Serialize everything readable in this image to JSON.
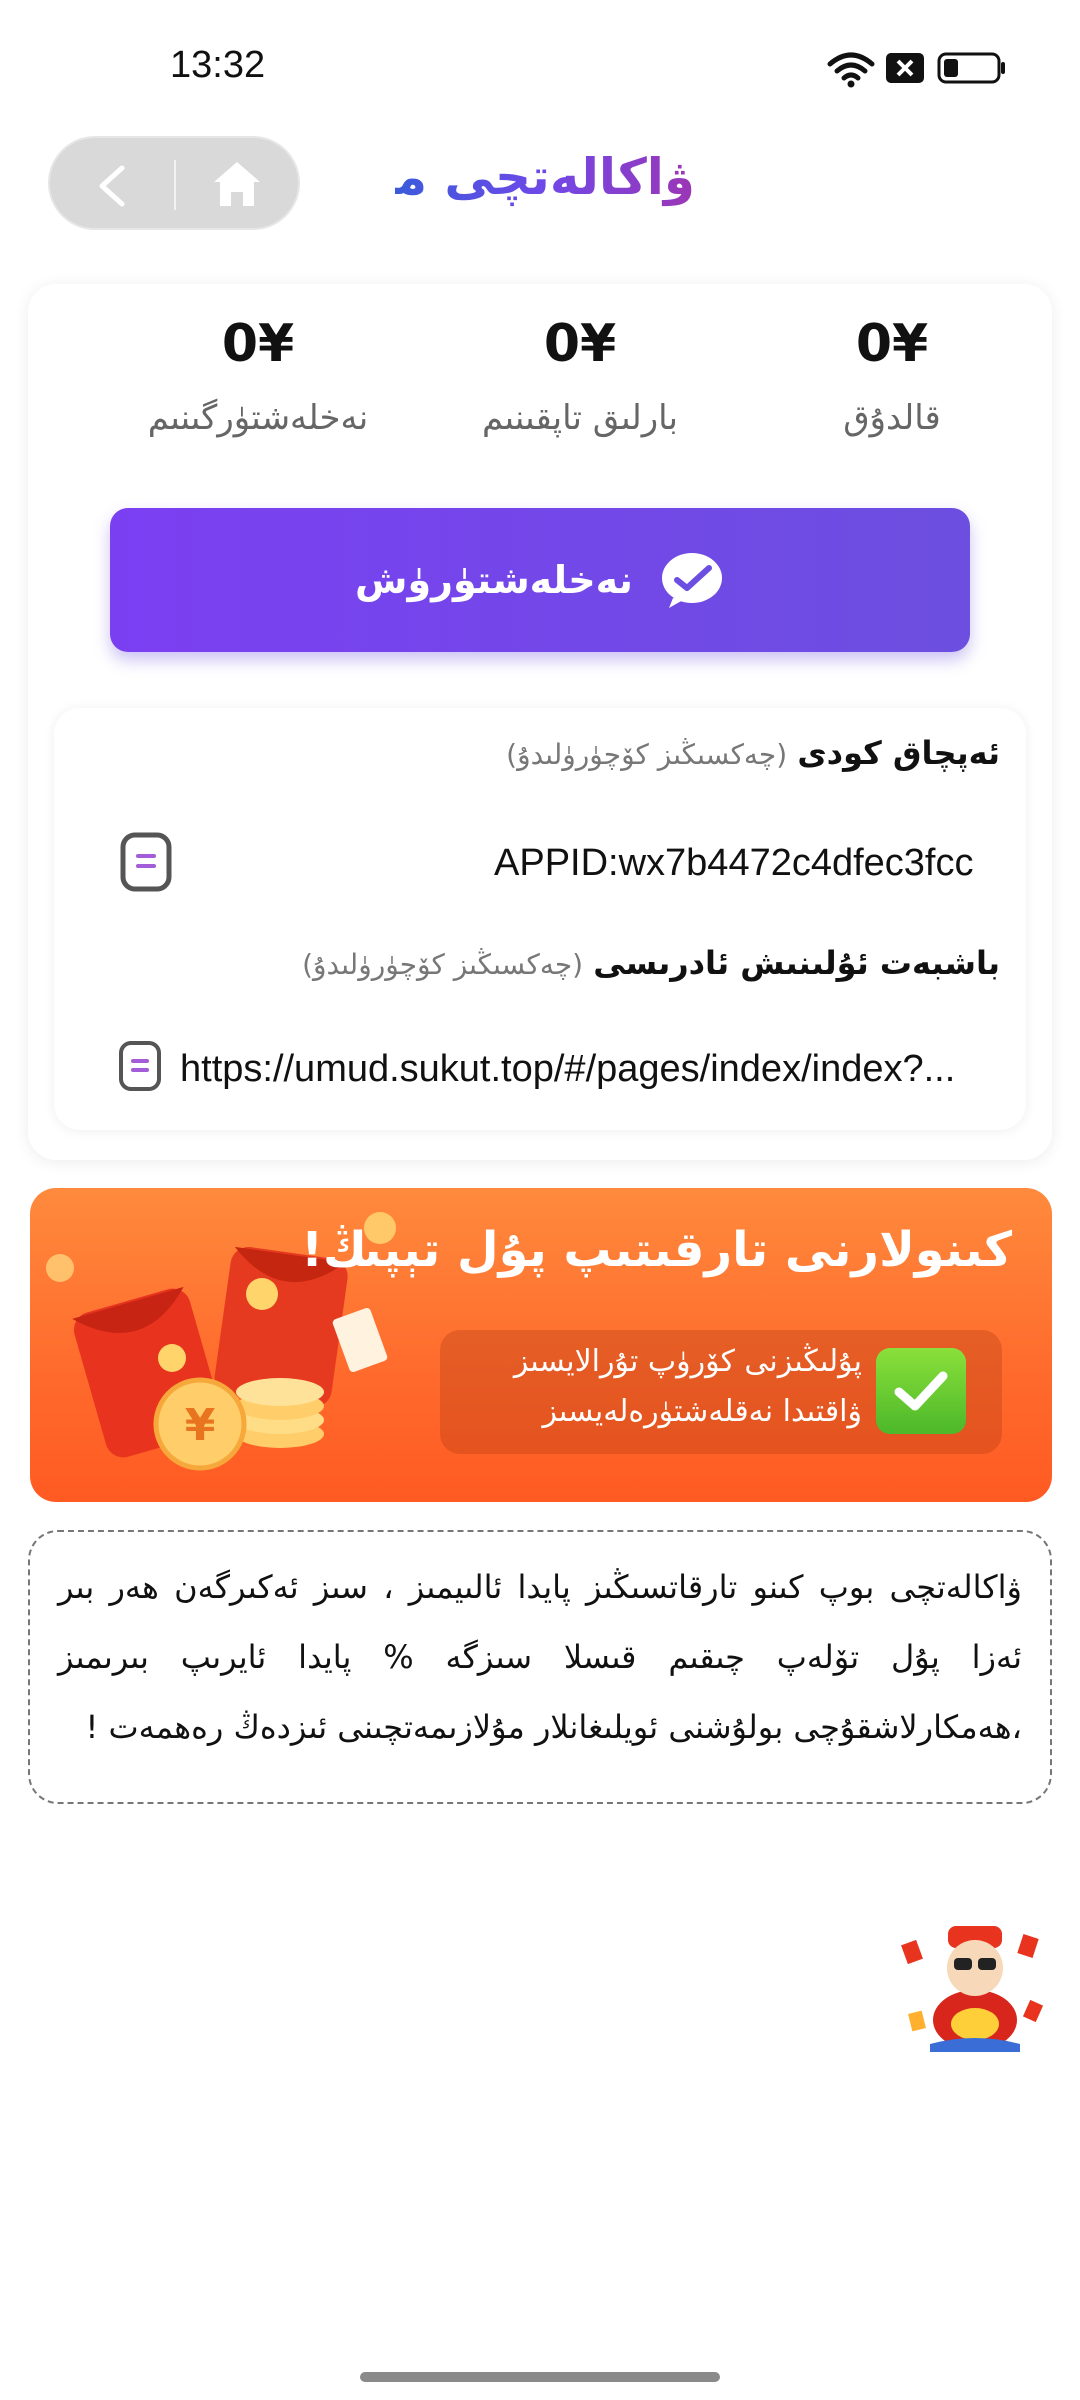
{
  "status_bar": {
    "time": "13:32"
  },
  "header": {
    "logo_text": "ۋاكالەتچى مەركىزى"
  },
  "stats": [
    {
      "value": "0¥",
      "label": "قالدۇق"
    },
    {
      "value": "0¥",
      "label": "بارلىق تاپقىنىم"
    },
    {
      "value": "0¥",
      "label": "نەخلەشتۈرگىنىم"
    }
  ],
  "withdraw_button": {
    "label": "نەخلەشتۈرۈش"
  },
  "appid_section": {
    "title": "ئەپچاق كودى",
    "hint": "(چەكسىڭىز كۆچۈرۈلىدۇ)",
    "value": "APPID:wx7b4472c4dfec3fcc"
  },
  "address_section": {
    "title": "باشبەت ئۇلىنىش ئادرىسى",
    "hint": "(چەكسىڭىز كۆچۈرۈلىدۇ)",
    "value": "https://umud.sukut.top/#/pages/index/index?..."
  },
  "banner": {
    "title": "كىنولارنى تارقىتىپ پۇل تېپىڭ!",
    "line1": "پۇلىڭىزنى كۆرۈپ تۇرالايسىز",
    "line2": "ۋاقتىدا نەقلەشتۈرەلەيسىز"
  },
  "notice": {
    "text": "ۋاكالەتچى بوپ كىنو تارقاتسىڭىز پايدا ئالىيمىز ، سىز ئەكىرگەن ھەر بىر ئەزا پۇل تۆلەپ چىقىم قىسلا سىزگە % پايدا ئايرىپ بىرىمىز ،ھەمكارلاشقۇچى بولۇشنى ئويلىغانلار مۇلازىمەتچىنى ئىزدەڭ رەھمەت !"
  },
  "colors": {
    "accent": "#7048e8",
    "banner": "#ff6a2c"
  }
}
